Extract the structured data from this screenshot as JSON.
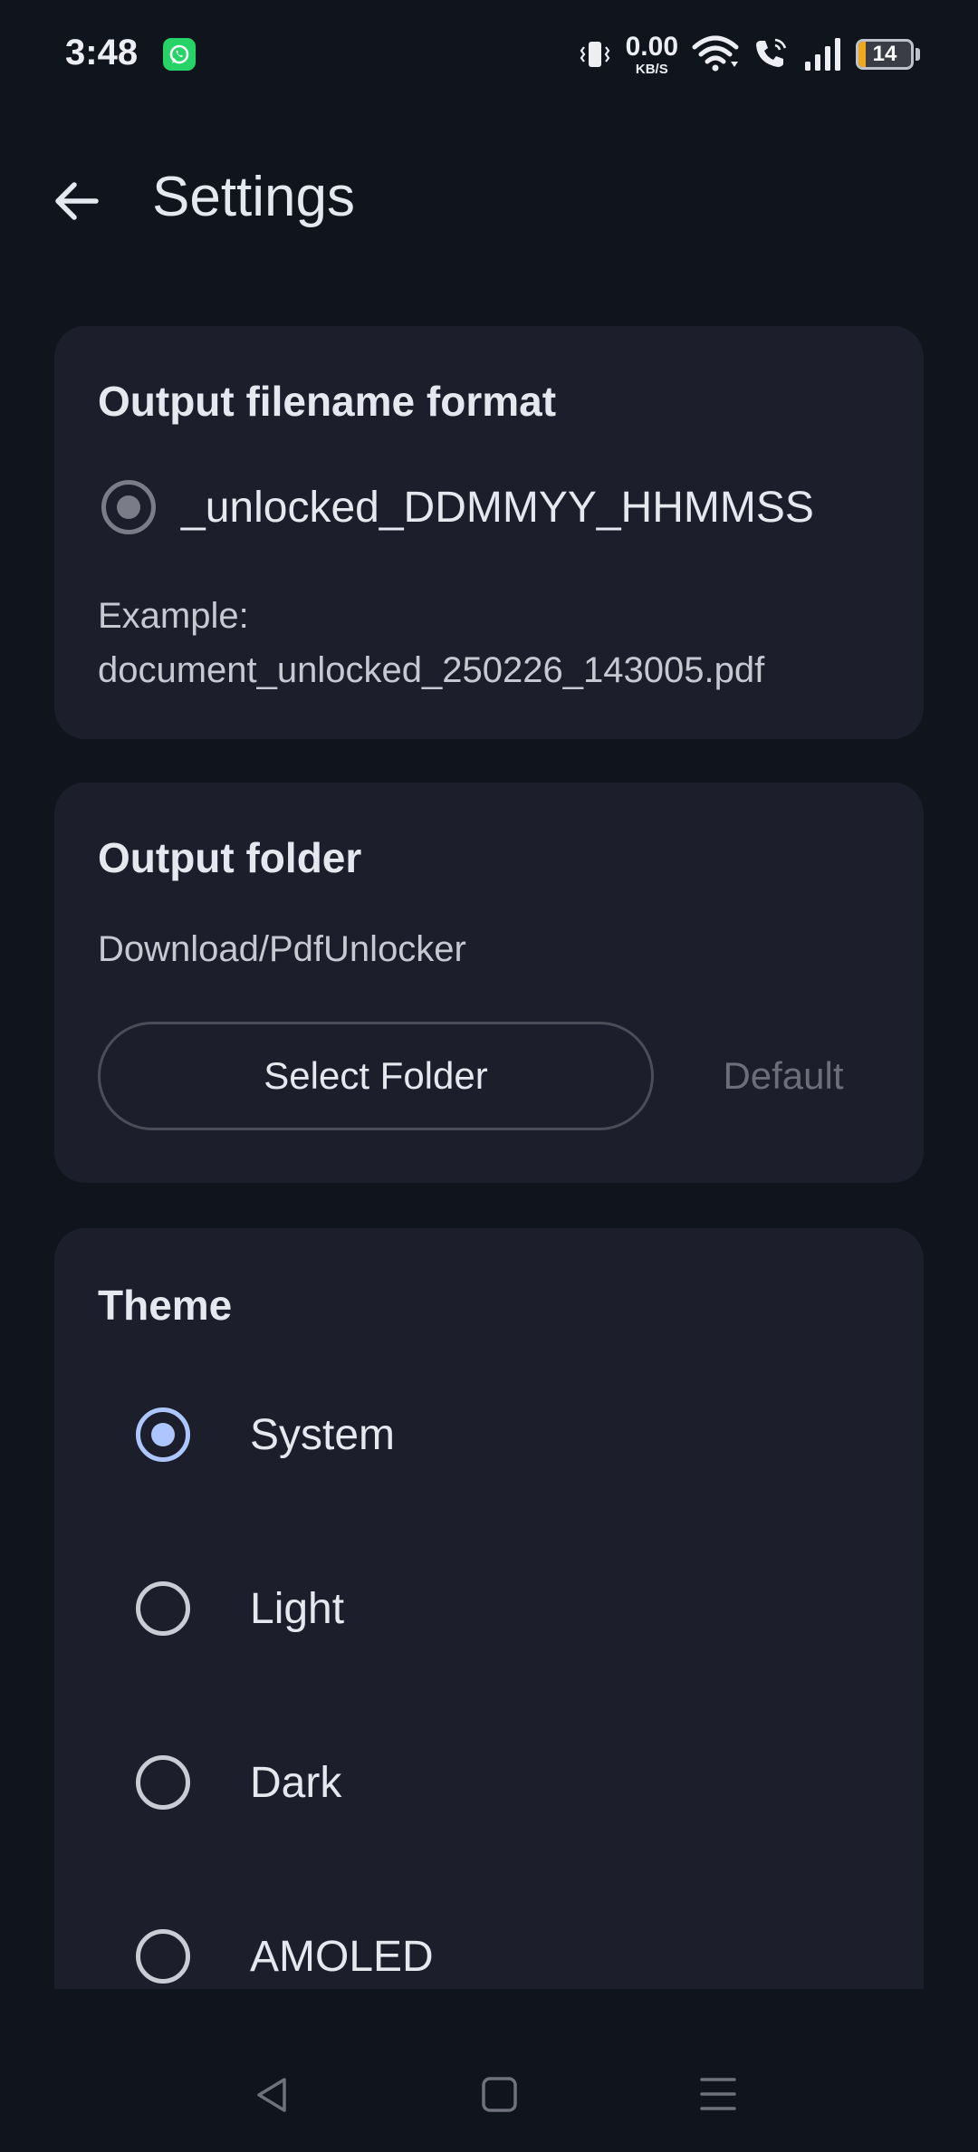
{
  "status_bar": {
    "time": "3:48",
    "net_speed_value": "0.00",
    "net_speed_unit": "KB/S",
    "battery_level": "14",
    "battery_fraction": 0.14,
    "icons": [
      "whatsapp-icon",
      "vibrate-icon",
      "wifi-icon",
      "wifi-calling-icon",
      "signal-icon",
      "battery-icon"
    ]
  },
  "app_bar": {
    "title": "Settings",
    "back_icon": "arrow-left-icon"
  },
  "filename_card": {
    "title": "Output filename format",
    "option_label": "_unlocked_DDMMYY_HHMMSS",
    "example_label": "Example:",
    "example_value": "document_unlocked_250226_143005.pdf"
  },
  "folder_card": {
    "title": "Output folder",
    "path": "Download/PdfUnlocker",
    "select_button": "Select Folder",
    "default_button": "Default"
  },
  "theme_card": {
    "title": "Theme",
    "options": [
      {
        "label": "System",
        "selected": true
      },
      {
        "label": "Light",
        "selected": false
      },
      {
        "label": "Dark",
        "selected": false
      },
      {
        "label": "AMOLED",
        "selected": false
      }
    ]
  },
  "colors": {
    "background": "#10141d",
    "card": "#1c1f2b",
    "accent": "#aec6ff",
    "battery": "#f0a81d",
    "whatsapp": "#25d366"
  }
}
